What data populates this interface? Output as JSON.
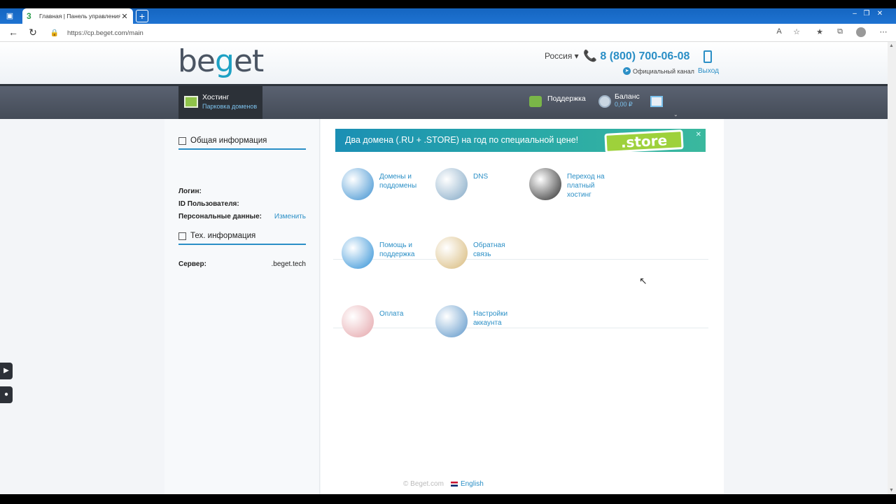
{
  "browser": {
    "tab_title": "Главная | Панель управления х",
    "favicon": "3",
    "close": "✕",
    "new_tab": "+",
    "url": "https://cp.beget.com/main"
  },
  "header": {
    "logo_a": "be",
    "logo_g": "g",
    "logo_b": "et",
    "country": "Россия ▾",
    "phone": "📞 8 (800) 700-06-08",
    "channel": "Официальный канал",
    "logout": "Выход"
  },
  "nav": {
    "hosting": "Хостинг",
    "hosting_sub": "Парковка доменов",
    "support": "Поддержка",
    "balance": "Баланс",
    "balance_value": "0,00 ₽"
  },
  "sidebar": {
    "general_title": "Общая информация",
    "login_label": "Логин:",
    "user_id_label": "ID Пользователя:",
    "personal_label": "Персональные данные:",
    "change_link": "Изменить",
    "tech_title": "Тех. информация",
    "server_label": "Сервер:",
    "server_value": ".beget.tech"
  },
  "banner": {
    "text": "Два домена (.RU + .STORE) на год по специальной цене!",
    "store": ".store"
  },
  "tiles": [
    {
      "label": "Домены и поддомены",
      "icon": "globe-keys-icon",
      "color": "#3a8fd0"
    },
    {
      "label": "DNS",
      "icon": "network-globe-icon",
      "color": "#7fa6c4"
    },
    {
      "label": "Переход на платный хостинг",
      "icon": "wallet-icon",
      "color": "#2a2a2a"
    },
    {
      "label": "Помощь и поддержка",
      "icon": "help-bubbles-icon",
      "color": "#2d8fd6"
    },
    {
      "label": "Обратная связь",
      "icon": "clipboard-icon",
      "color": "#d7b878"
    },
    {
      "label": "Оплата",
      "icon": "piggy-bank-icon",
      "color": "#e4a3a8"
    },
    {
      "label": "Настройки аккаунта",
      "icon": "account-settings-icon",
      "color": "#5a94c8"
    }
  ],
  "footer": {
    "copyright": "© Beget.com",
    "language": "English"
  }
}
